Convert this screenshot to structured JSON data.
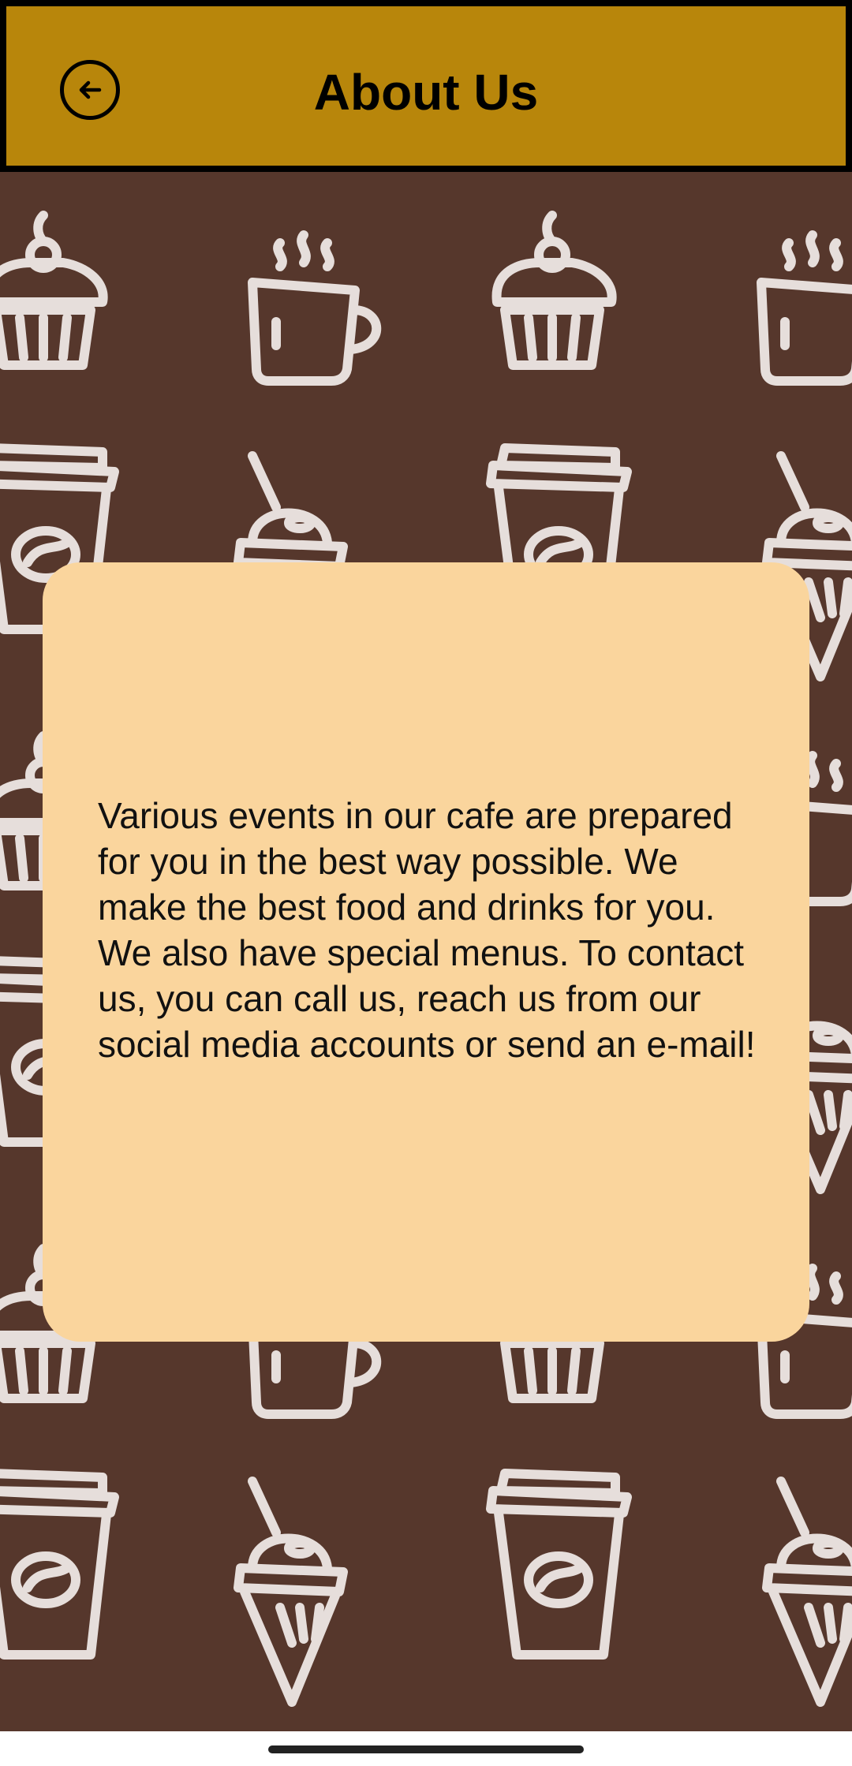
{
  "header": {
    "title": "About Us",
    "back_icon": "back-arrow-icon",
    "background_color": "#b8860b"
  },
  "background": {
    "color": "#56372c",
    "pattern_color": "#e6dedb",
    "pattern_icons": [
      "cupcake-icon",
      "coffee-cup-icon",
      "takeaway-cup-icon",
      "slushie-cup-icon"
    ]
  },
  "card": {
    "background_color": "#fad59d",
    "text": "Various events in our cafe are prepared for you in the best way possible. We make the best food and drinks for you. We also have special menus. To contact us, you can call us, reach us from our social media accounts or send an e-mail!"
  }
}
